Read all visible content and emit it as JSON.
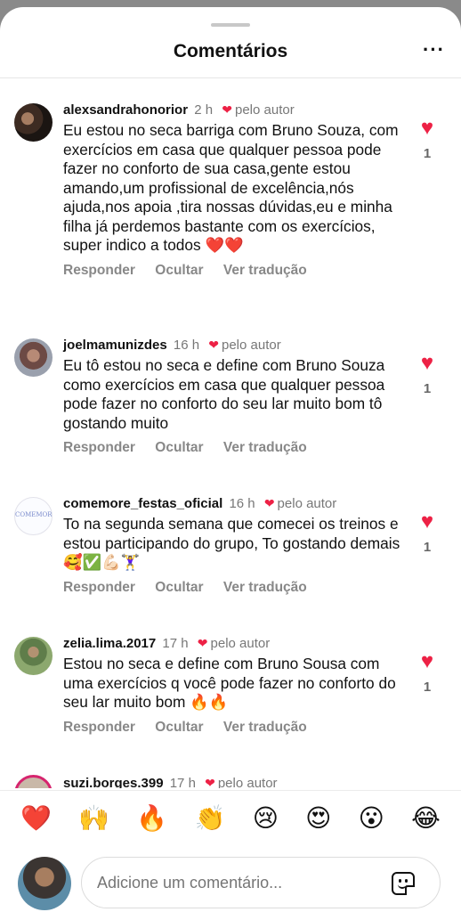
{
  "header": {
    "title": "Comentários",
    "more_icon": "more-horizontal-icon",
    "more_label": "···"
  },
  "comments": [
    {
      "username": "alexsandrahonorior",
      "time": "2 h",
      "liked_by": "pelo autor",
      "text": "Eu estou no seca barriga com Bruno Souza, com exercícios em casa que qualquer pessoa pode fazer no conforto de sua casa,gente estou amando,um profissional de excelência,nós ajuda,nos apoia ,tira nossas dúvidas,eu e minha filha já perdemos bastante com os exercícios, super indico a todos ❤️❤️",
      "likes": "1",
      "actions": [
        "Responder",
        "Ocultar",
        "Ver tradução"
      ]
    },
    {
      "username": "joelmamunizdes",
      "time": "16 h",
      "liked_by": "pelo autor",
      "text": "Eu tô estou no seca e define com Bruno Souza como exercícios em casa que qualquer pessoa pode fazer no conforto do seu lar muito bom tô gostando muito",
      "likes": "1",
      "actions": [
        "Responder",
        "Ocultar",
        "Ver tradução"
      ]
    },
    {
      "username": "comemore_festas_oficial",
      "time": "16 h",
      "liked_by": "pelo autor",
      "text": "To na segunda semana que comecei os treinos e estou participando do grupo, To gostando demais 🥰✅💪🏻🏋️‍♀️",
      "likes": "1",
      "actions": [
        "Responder",
        "Ocultar",
        "Ver tradução"
      ],
      "avatar_text": "COMEMORE"
    },
    {
      "username": "zelia.lima.2017",
      "time": "17 h",
      "liked_by": "pelo autor",
      "text": "Estou no seca e define com Bruno Sousa com uma exercícios q você pode fazer no conforto do seu lar muito bom 🔥🔥",
      "likes": "1",
      "actions": [
        "Responder",
        "Ocultar",
        "Ver tradução"
      ]
    },
    {
      "username": "suzi.borges.399",
      "time": "17 h",
      "liked_by": "pelo autor"
    }
  ],
  "emoji_bar": [
    "❤️",
    "🙌",
    "🔥",
    "👏",
    "😢",
    "😍",
    "😮",
    "😂"
  ],
  "composer": {
    "placeholder": "Adicione um comentário...",
    "sticker_icon": "sticker-icon"
  },
  "colors": {
    "heart": "#ed2145",
    "muted": "#888888",
    "story_ring": "#d6246e"
  }
}
